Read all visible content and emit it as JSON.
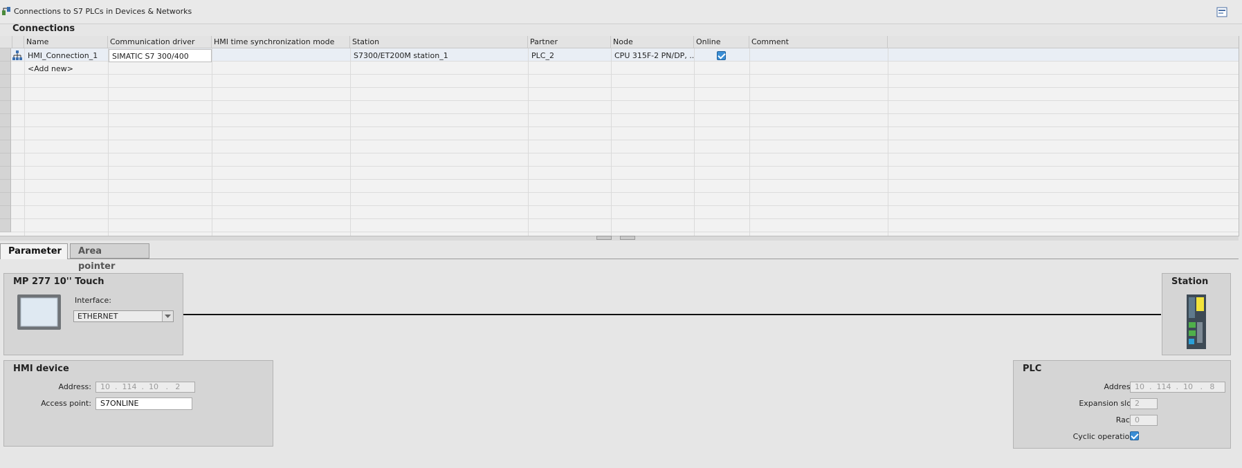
{
  "window": {
    "title": "Connections to S7 PLCs in Devices & Networks"
  },
  "section": {
    "title": "Connections"
  },
  "table": {
    "columns": [
      "Name",
      "Communication driver",
      "HMI time synchronization mode",
      "Station",
      "Partner",
      "Node",
      "Online",
      "Comment"
    ],
    "rows": [
      {
        "name": "HMI_Connection_1",
        "driver": "SIMATIC S7 300/400",
        "sync_mode": "",
        "station": "S7300/ET200M station_1",
        "partner": "PLC_2",
        "node": "CPU 315F-2 PN/DP, ...",
        "online": true,
        "comment": ""
      }
    ],
    "add_new": "<Add new>"
  },
  "tabs": [
    {
      "label": "Parameter",
      "active": true
    },
    {
      "label": "Area pointer",
      "active": false
    }
  ],
  "device": {
    "title": "MP 277 10'' Touch",
    "interface_label": "Interface:",
    "interface_value": "ETHERNET"
  },
  "station": {
    "title": "Station"
  },
  "hmi_device": {
    "title": "HMI device",
    "address_label": "Address:",
    "address_value": "10  .  114  .  10   .   2",
    "access_point_label": "Access point:",
    "access_point_value": "S7ONLINE"
  },
  "plc": {
    "title": "PLC",
    "address_label": "Address:",
    "address_value": "10  .  114  .  10   .   8",
    "expansion_slot_label": "Expansion slot:",
    "expansion_slot_value": "2",
    "rack_label": "Rack:",
    "rack_value": "0",
    "cyclic_label": "Cyclic operation:",
    "cyclic_value": true
  },
  "icons": [
    "connections-icon",
    "pin-icon",
    "network-icon",
    "hmi-panel-icon",
    "dropdown-arrow-icon",
    "plc-station-icon",
    "checkbox-checked-icon"
  ],
  "colors": {
    "accent": "#3a8ed6",
    "panel": "#d5d5d5",
    "background": "#e6e6e6"
  }
}
